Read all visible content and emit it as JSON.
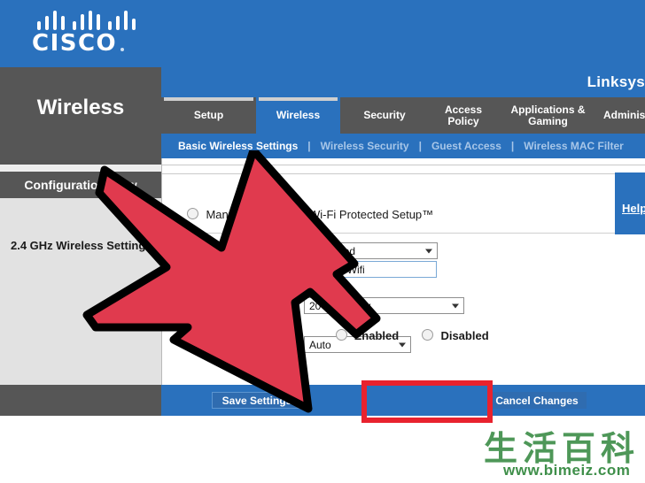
{
  "brand": {
    "logo_text": "CISCO",
    "logo_mark": "cisco-bridge-bars",
    "product_label": "Linksys"
  },
  "colors": {
    "header_blue": "#2a71bd",
    "dark_gray": "#565656",
    "panel_gray": "#e2e2e2",
    "arrow_red": "#e03a4e",
    "highlight_red": "#e8222e",
    "watermark_green": "#3f8f4a"
  },
  "sidebar": {
    "title": "Wireless",
    "section_header": "Configuration View",
    "field_label": "2.4 GHz Wireless Settings"
  },
  "tabs": [
    {
      "label": "Setup",
      "selected": false
    },
    {
      "label": "Wireless",
      "selected": true
    },
    {
      "label": "Security",
      "selected": false
    },
    {
      "label": "Access Policy",
      "selected": false
    },
    {
      "label": "Applications & Gaming",
      "selected": false
    },
    {
      "label": "Administration",
      "selected": false
    }
  ],
  "subtabs": [
    {
      "label": "Basic Wireless Settings",
      "selected": true
    },
    {
      "label": "Wireless Security",
      "selected": false
    },
    {
      "label": "Guest Access",
      "selected": false
    },
    {
      "label": "Wireless MAC Filter",
      "selected": false
    }
  ],
  "subtab_separator": "|",
  "content": {
    "help_link": "Help",
    "wps_mode": {
      "manual_label": "Manual",
      "manual_selected": false,
      "wps_label": "Wi-Fi Protected Setup™",
      "wps_selected": false
    },
    "fields": [
      {
        "name": "network-mode",
        "type": "select",
        "value": "Mixed"
      },
      {
        "name": "network-name-ssid",
        "type": "text",
        "value": "WikiWifi"
      },
      {
        "name": "channel-width",
        "type": "select",
        "value": "20 MHz Only"
      },
      {
        "name": "channel",
        "type": "select",
        "value": "Auto"
      }
    ],
    "ssid_broadcast": {
      "enabled_label": "Enabled",
      "disabled_label": "Disabled",
      "enabled_selected": true,
      "disabled_selected": false
    }
  },
  "actions": {
    "save_label": "Save Settings",
    "cancel_label": "Cancel Changes",
    "highlighted": "save-settings"
  },
  "annotation": {
    "type": "arrow",
    "points_to": "Save Settings",
    "color": "#e03a4e"
  },
  "watermark": {
    "cjk": "生活百科",
    "url": "www.bimeiz.com"
  }
}
